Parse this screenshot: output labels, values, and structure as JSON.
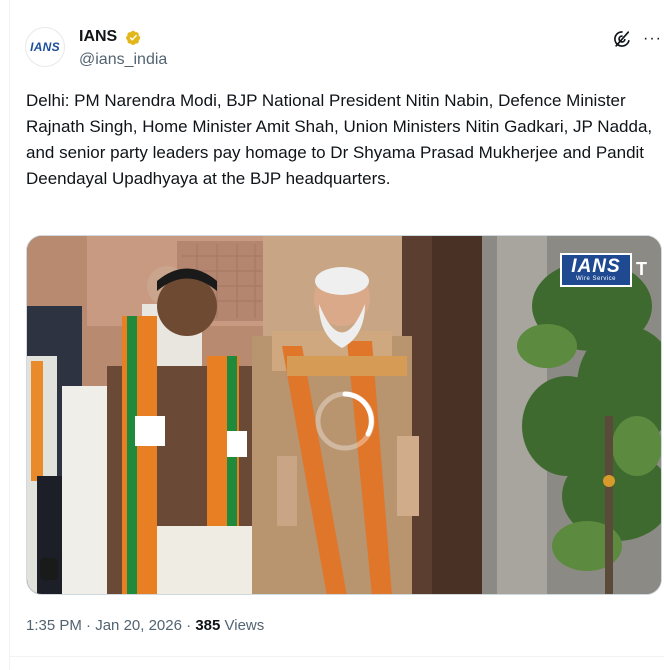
{
  "author": {
    "avatar_text": "IANS",
    "display_name": "IANS",
    "handle": "@ians_india",
    "verified_badge": "gold-verified-icon"
  },
  "header_icons": {
    "grok": "grok-icon",
    "more": "more-options-icon",
    "more_glyph": "···"
  },
  "tweet": {
    "text": "Delhi: PM Narendra Modi, BJP National President Nitin Nabin, Defence Minister Rajnath Singh, Home Minister Amit Shah, Union Ministers Nitin Gadkari, JP Nadda, and senior party leaders pay homage to Dr Shyama Prasad Mukherjee and Pandit Deendayal Upadhyaya at the BJP headquarters."
  },
  "media": {
    "watermark_main": "IANS",
    "watermark_sub": "Wire Service",
    "watermark_tail": "T"
  },
  "meta": {
    "time": "1:35 PM",
    "separator": " · ",
    "date": "Jan 20, 2026",
    "views_count": "385",
    "views_label": "Views"
  },
  "colors": {
    "verified_gold": "#e2b719",
    "text_primary": "#0f1419",
    "text_secondary": "#536471",
    "brand_blue": "#1f4a92"
  }
}
